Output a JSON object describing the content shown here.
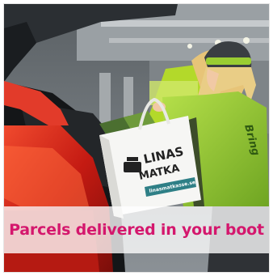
{
  "card": {
    "caption": "Parcels delivered in your boot",
    "bag_brand_line1": "LINAS",
    "bag_brand_line2": "MATKA",
    "bag_url": "linasmatkasse.se",
    "jacket_print": "Bring"
  },
  "colors": {
    "caption": "#d4176d",
    "jacket": "#9acd32",
    "tail_light": "#d8271b",
    "bag_stripe": "#2e7f86"
  },
  "icons": {
    "bag_logo": "pot-icon"
  }
}
